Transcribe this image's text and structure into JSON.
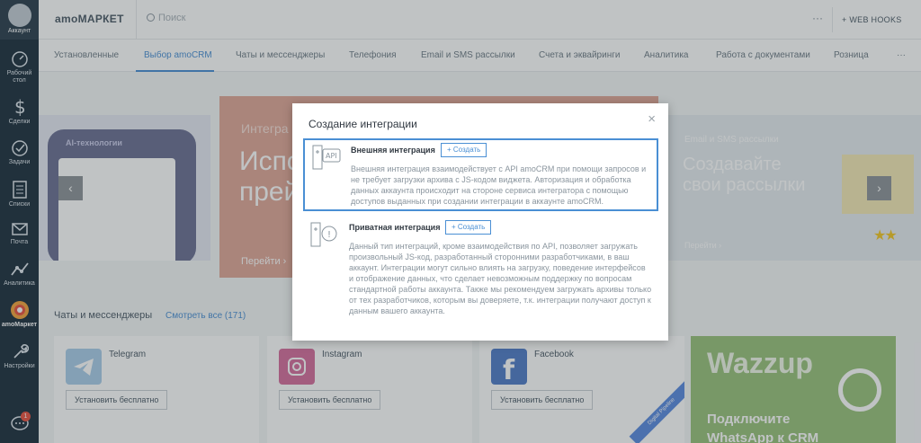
{
  "leftnav": {
    "account_label": "Аккаунт",
    "items": [
      {
        "label": "Рабочий\nстол",
        "icon": "dashboard-icon"
      },
      {
        "label": "Сделки",
        "icon": "deals-dollar-icon"
      },
      {
        "label": "Задачи",
        "icon": "tasks-check-icon"
      },
      {
        "label": "Списки",
        "icon": "lists-icon"
      },
      {
        "label": "Почта",
        "icon": "mail-icon"
      },
      {
        "label": "Аналитика",
        "icon": "analytics-icon"
      },
      {
        "label": "amoМаркет",
        "icon": "amomarket-icon"
      },
      {
        "label": "Настройки",
        "icon": "settings-wrench-icon"
      }
    ],
    "chat_badge": "1"
  },
  "topbar": {
    "brand": "amoМАРКЕТ",
    "search_placeholder": "Поиск",
    "more": "···",
    "webhooks": "+ WEB HOOKS"
  },
  "tabs": [
    {
      "label": "Установленные",
      "active": false
    },
    {
      "label": "Выбор amoCRM",
      "active": true
    },
    {
      "label": "Чаты и мессенджеры",
      "active": false
    },
    {
      "label": "Телефония",
      "active": false
    },
    {
      "label": "Email и SMS рассылки",
      "active": false
    },
    {
      "label": "Счета и эквайринги",
      "active": false
    },
    {
      "label": "Аналитика",
      "active": false
    },
    {
      "label": "Работа с документами",
      "active": false
    },
    {
      "label": "Розница",
      "active": false
    },
    {
      "label": "···",
      "active": false
    }
  ],
  "banners": {
    "left_title": "AI-технологии",
    "middle": {
      "subtitle": "Интегра",
      "headline_1": "Испо",
      "headline_2": "прей",
      "link": "Перейти ›"
    },
    "right": {
      "subtitle": "Email и SMS рассылки",
      "headline_1": "Создавайте",
      "headline_2": "свои рассылки",
      "link": "Перейти ›"
    },
    "prev": "‹",
    "next": "›",
    "stars": "★★"
  },
  "section": {
    "title": "Чаты и мессенджеры",
    "see_all": "Смотреть все (171)"
  },
  "apps": [
    {
      "name": "Telegram",
      "install": "Установить бесплатно",
      "color": "#a9cdea"
    },
    {
      "name": "Instagram",
      "install": "Установить бесплатно",
      "color": "#d66d9c"
    },
    {
      "name": "Facebook",
      "install": "Установить бесплатно",
      "color": "#4f7bc7",
      "ribbon": "Digital Pipeline"
    }
  ],
  "wazzup": {
    "brand": "Wazzup",
    "cta_1": "Подключите",
    "cta_2": "WhatsApp к CRM"
  },
  "modal": {
    "title": "Создание интеграции",
    "close": "×",
    "options": [
      {
        "name": "Внешняя интеграция",
        "add": "+ Создать",
        "icon_label": "API",
        "description": "Внешняя интеграция взаимодействует с API amoCRM при помощи запросов и не требует загрузки архива с JS-кодом виджета. Авторизация и обработка данных аккаунта происходит на стороне сервиса интегратора с помощью доступов выданных при создании интеграции в аккаунте amoCRM."
      },
      {
        "name": "Приватная интеграция",
        "add": "+ Создать",
        "icon_label": "!",
        "description": "Данный тип интеграций, кроме взаимодействия по API, позволяет загружать произвольный JS-код, разработанный сторонними разработчиками, в ваш аккаунт. Интеграции могут сильно влиять на загрузку, поведение интерфейсов и отображение данных, что сделает невозможным поддержку по вопросам стандартной работы аккаунта. Также мы рекомендуем загружать архивы только от тех разработчиков, которым вы доверяете, т.к. интеграции получают доступ к данным вашего аккаунта."
      }
    ]
  },
  "colors": {
    "nav_bg": "#1c2e3d",
    "accent": "#4a8fd4",
    "banner_mid": "#e0a797",
    "wazzup_green": "#98c27a"
  }
}
